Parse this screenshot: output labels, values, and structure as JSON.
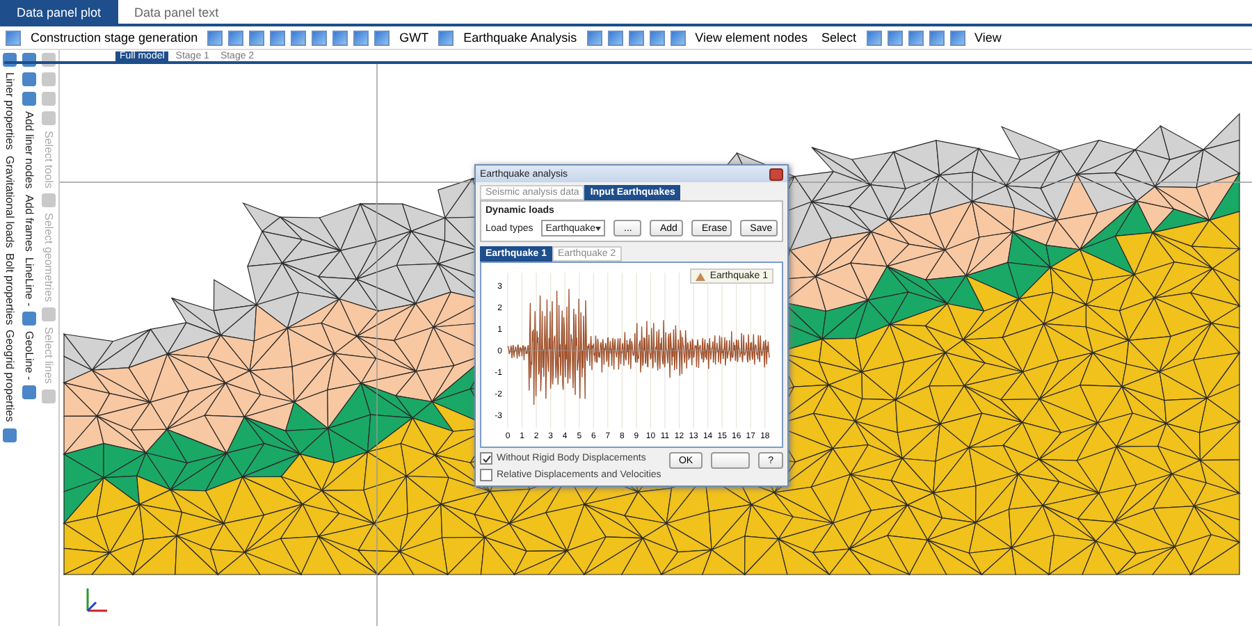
{
  "tabs": [
    {
      "label": "Data panel plot",
      "selected": true
    },
    {
      "label": "Data panel text",
      "selected": false
    }
  ],
  "toolbar": [
    {
      "kind": "icon"
    },
    {
      "kind": "text",
      "label": "Construction stage generation"
    },
    {
      "kind": "icon"
    },
    {
      "kind": "icon"
    },
    {
      "kind": "icon"
    },
    {
      "kind": "icon"
    },
    {
      "kind": "icon"
    },
    {
      "kind": "icon"
    },
    {
      "kind": "icon"
    },
    {
      "kind": "icon"
    },
    {
      "kind": "icon"
    },
    {
      "kind": "text",
      "label": "GWT"
    },
    {
      "kind": "icon"
    },
    {
      "kind": "text",
      "label": "Earthquake Analysis"
    },
    {
      "kind": "icon"
    },
    {
      "kind": "icon"
    },
    {
      "kind": "icon"
    },
    {
      "kind": "icon"
    },
    {
      "kind": "icon"
    },
    {
      "kind": "text",
      "label": "View element nodes"
    },
    {
      "kind": "text",
      "label": "Select"
    },
    {
      "kind": "icon"
    },
    {
      "kind": "icon"
    },
    {
      "kind": "icon"
    },
    {
      "kind": "icon"
    },
    {
      "kind": "icon"
    },
    {
      "kind": "text",
      "label": "View"
    }
  ],
  "stage_tabs": [
    {
      "label": "Full model",
      "selected": true
    },
    {
      "label": "Stage 1",
      "selected": false
    },
    {
      "label": "Stage 2",
      "selected": false
    }
  ],
  "side_panel": [
    {
      "disabled": false,
      "items": [
        {
          "kind": "icon"
        },
        {
          "kind": "label",
          "label": "Liner properties"
        },
        {
          "kind": "label",
          "label": "Gravitational loads"
        },
        {
          "kind": "label",
          "label": "Bolt properties"
        },
        {
          "kind": "label",
          "label": "Geogrid properties"
        },
        {
          "kind": "icon"
        }
      ]
    },
    {
      "disabled": false,
      "items": [
        {
          "kind": "icon"
        },
        {
          "kind": "icon"
        },
        {
          "kind": "icon"
        },
        {
          "kind": "label",
          "label": "Add liner nodes"
        },
        {
          "kind": "label",
          "label": "Add frames"
        },
        {
          "kind": "label",
          "label": "LineLine -"
        },
        {
          "kind": "icon"
        },
        {
          "kind": "label",
          "label": "GeoLine -"
        },
        {
          "kind": "icon"
        }
      ]
    },
    {
      "disabled": true,
      "items": [
        {
          "kind": "icon"
        },
        {
          "kind": "icon"
        },
        {
          "kind": "icon"
        },
        {
          "kind": "icon"
        },
        {
          "kind": "label",
          "label": "Select tools"
        },
        {
          "kind": "icon"
        },
        {
          "kind": "label",
          "label": "Select geometries"
        },
        {
          "kind": "icon"
        },
        {
          "kind": "label",
          "label": "Select lines"
        },
        {
          "kind": "icon"
        }
      ]
    }
  ],
  "dialog": {
    "title": "Earthquake analysis",
    "tabs": [
      {
        "label": "Seismic analysis data",
        "selected": false
      },
      {
        "label": "Input Earthquakes",
        "selected": true
      }
    ],
    "group_title": "Dynamic loads",
    "load_types_label": "Load types",
    "load_type_value": "Earthquake",
    "buttons": [
      "...",
      "Add",
      "Erase",
      "Save"
    ],
    "record_tabs": [
      {
        "label": "Earthquake 1",
        "selected": true
      },
      {
        "label": "Earthquake 2",
        "selected": false
      }
    ],
    "chart": {
      "legend": "Earthquake 1",
      "x_tick_labels": [
        "0",
        "1",
        "2",
        "3",
        "4",
        "5",
        "6",
        "7",
        "8",
        "9",
        "10",
        "11",
        "12",
        "13",
        "14",
        "15",
        "16",
        "17",
        "18"
      ],
      "y_tick_labels": [
        "3",
        "2",
        "1",
        "0",
        "-1",
        "-2",
        "-3"
      ]
    },
    "options": [
      {
        "label": "Without Rigid Body Displacements",
        "checked": true
      },
      {
        "label": "Relative Displacements and Velocities",
        "checked": false
      }
    ],
    "footer_buttons": [
      {
        "kind": "text",
        "label": "OK"
      },
      {
        "kind": "blank"
      },
      {
        "kind": "text",
        "label": "?"
      }
    ]
  }
}
